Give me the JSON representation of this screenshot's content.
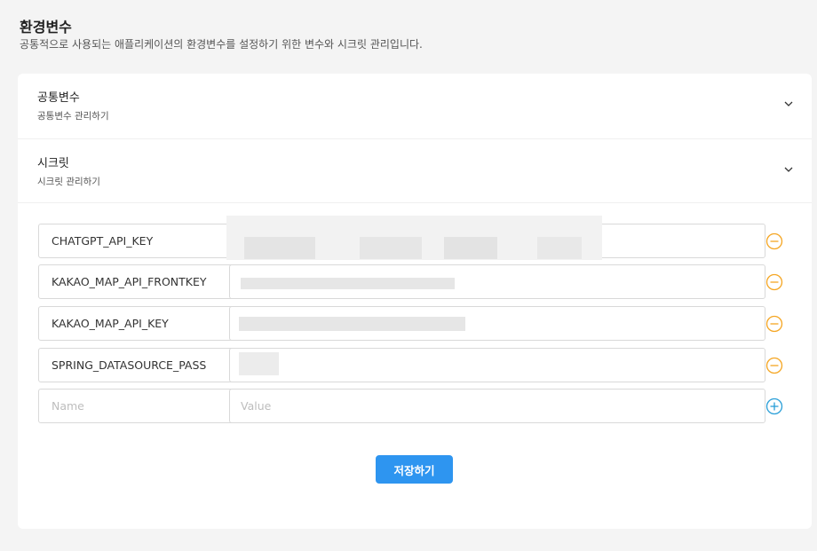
{
  "page": {
    "title": "환경변수",
    "subtitle": "공통적으로 사용되는 애플리케이션의 환경변수를 설정하기 위한 변수와 시크릿 관리입니다."
  },
  "sections": [
    {
      "title": "공통변수",
      "subtitle": "공통변수 관리하기",
      "icon": "chevron-down-icon"
    },
    {
      "title": "시크릿",
      "subtitle": "시크릿 관리하기",
      "icon": "chevron-down-icon"
    }
  ],
  "secrets": [
    {
      "name": "CHATGPT_API_KEY",
      "value_redacted": true,
      "action": "remove-circle-icon"
    },
    {
      "name": "KAKAO_MAP_API_FRONTKEY",
      "value_redacted": true,
      "action": "remove-circle-icon"
    },
    {
      "name": "KAKAO_MAP_API_KEY",
      "value_redacted": true,
      "action": "remove-circle-icon"
    },
    {
      "name": "SPRING_DATASOURCE_PASS",
      "value_redacted": true,
      "action": "remove-circle-icon"
    }
  ],
  "new_row": {
    "name_placeholder": "Name",
    "value_placeholder": "Value",
    "action": "add-circle-icon"
  },
  "save_button": {
    "label": "저장하기"
  },
  "colors": {
    "remove_icon": "#f5a623",
    "add_icon": "#2a9fd8",
    "primary": "#2e95f0"
  }
}
